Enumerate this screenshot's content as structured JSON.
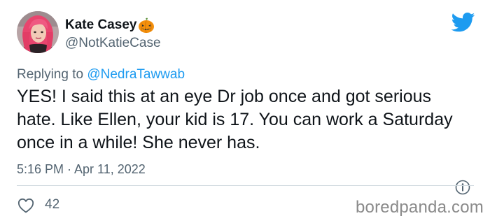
{
  "author": {
    "display_name": "Kate Casey",
    "name_emoji_icon": "jack-o-lantern-icon",
    "handle": "@NotKatieCase",
    "avatar_icon": "profile-photo-pink-hair"
  },
  "platform_icon": "twitter-bird-icon",
  "reply": {
    "prefix": "Replying to",
    "mention": "@NedraTawwab"
  },
  "tweet": {
    "text": "YES! I said this at an eye Dr job once and got serious hate. Like Ellen, your kid is 17. You can work a Saturday once in a while! She never has.",
    "timestamp": "5:16 PM · Apr 11, 2022"
  },
  "actions": {
    "like_count": "42",
    "like_icon": "heart-outline-icon",
    "info_icon": "info-circle-icon"
  },
  "watermark": "boredpanda.com",
  "colors": {
    "accent": "#1d9bf0",
    "text_primary": "#0f1419",
    "text_secondary": "#536471",
    "divider": "#cfd9de",
    "hair_pink": "#e8456e",
    "pumpkin_orange": "#f4900c"
  }
}
